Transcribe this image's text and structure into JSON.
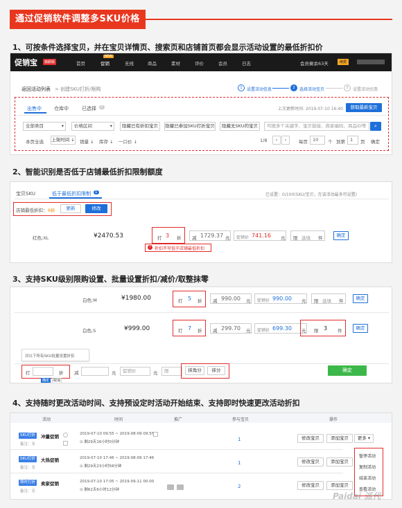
{
  "banner": {
    "title": "通过促销软件调整多SKU价格"
  },
  "headings": {
    "h1": "1、可按条件选择宝贝，并在宝贝详情页、搜索页和店铺首页都会显示活动设置的最低折扣价",
    "h2": "2、智能识别是否低于店铺最低折扣限制额度",
    "h3": "3、支持SKU级别限购设置、批量设置折扣/减价/取整抹零",
    "h4": "4、支持随时更改活动时间、支持预设定时活动开始结束、支持即时快速更改活动折扣"
  },
  "s1": {
    "logo": "促销宝",
    "logo_tag": "旗舰版",
    "nav": [
      "首页",
      "促销",
      "无线",
      "商品",
      "素材",
      "评价",
      "会员",
      "日志"
    ],
    "nav_new_badge": "NEW",
    "account": "会员剩余63天",
    "account_badge": "续费",
    "breadcrumb_link": "返回活动列表",
    "breadcrumb_rest": "> 创建SKU打折/限购",
    "steps": [
      "设置活动信息",
      "选择活动宝贝",
      "设置活动优惠"
    ],
    "step_nums": [
      "1",
      "2",
      "3"
    ],
    "tabs": [
      "出售中",
      "仓库中",
      "已选择"
    ],
    "selected_count": "0",
    "update_time": "上次更新时间: 2019-07-10 16:40",
    "sync_button": "获取最新宝贝",
    "filters": [
      "全部类目",
      "价格区间"
    ],
    "filter_buttons": [
      "隐藏已有折扣宝贝",
      "隐藏已参加SKU打折宝贝",
      "隐藏无SKU的宝贝"
    ],
    "search_placeholder": "可搜多个关键字、宝贝链接、商家编码、商品ID等",
    "row3": {
      "select_all": "本页全选",
      "sort": [
        "上架时间 ↓",
        "销量 ↓",
        "库存 ↓",
        "一口价 ↓"
      ],
      "page_info": "1/8",
      "per_page_label": "每页",
      "per_page_value": "10",
      "per_page_unit": "个",
      "goto_label": "到第",
      "goto_value": "1",
      "goto_unit": "页",
      "confirm": "确定"
    }
  },
  "s2": {
    "tabs": [
      "宝贝SKU",
      "低于最低折扣限制"
    ],
    "tab_count": "1",
    "selected_info": "已设置：0/100(SKU/宝贝，在该活动最多可设置)",
    "min_discount_label": "店铺最低折扣：",
    "min_discount_value": "6折",
    "update_button": "更新",
    "edit_button": "修改",
    "sku_name": "红色;XL",
    "price": "¥2470.53",
    "discount_prefix": "打",
    "discount_value": "3",
    "discount_unit": "折",
    "minus_prefix": "减",
    "minus_value": "1729.37",
    "minus_unit": "元",
    "promo_label": "促销价",
    "promo_value": "741.16",
    "promo_unit": "元",
    "limit_prefix": "限",
    "limit_value": "选填",
    "limit_unit": "件",
    "confirm": "确定",
    "warning": "折扣不可低于店铺最低折扣"
  },
  "s3": {
    "rows": [
      {
        "sku": "白色;M",
        "price": "¥1980.00",
        "discount": "5",
        "minus": "990.00",
        "promo": "990.00",
        "limit": "选填"
      },
      {
        "sku": "白色;S",
        "price": "¥999.00",
        "discount": "7",
        "minus": "299.70",
        "promo": "699.30",
        "limit": "3"
      }
    ],
    "labels": {
      "dz": "打",
      "zhe": "折",
      "jian": "减",
      "yuan": "元",
      "cx": "促销价",
      "xian": "限",
      "jian2": "件",
      "confirm": "确定"
    },
    "batch_hint": "对以下所有SKU批量设置折扣",
    "batch": {
      "dz": "打",
      "zhe": "折",
      "jian": "减",
      "yuan": "元",
      "cx": "促销价",
      "yuan2": "元",
      "xian": "限",
      "jian2": "件"
    },
    "round_buttons": [
      "抹角分",
      "抹分"
    ],
    "ok": "确定",
    "cancel": "取消",
    "submit": "确定"
  },
  "s4": {
    "headers": [
      "活动",
      "时间",
      "推广",
      "参与宝贝",
      "操作"
    ],
    "rows": [
      {
        "tag": "SKU打折",
        "name": "冲量促销",
        "note": "备注：无",
        "time": "2019-07-10 09:55 ~ 2019-08-09 09:55",
        "remain": "剩29天16小时0分钟",
        "count": "1",
        "edit": "修改宝贝",
        "add": "添加宝贝",
        "more": "更多 ▾"
      },
      {
        "tag": "SKU打折",
        "name": "大热促销",
        "note": "备注：无",
        "time": "2019-07-10 17:46 ~ 2019-08-09 17:46",
        "remain": "剩29天23小时58分钟",
        "count": "1",
        "edit": "修改宝贝",
        "add": "添加宝贝"
      },
      {
        "tag": "限时打折",
        "name": "卖家促销",
        "note": "备注：无",
        "time": "2019-07-10 17:05 ~ 2019-09-11 00:00",
        "remain": "剩62天6小时12分钟",
        "count": "2",
        "edit": "修改宝贝",
        "add": "添加宝贝"
      }
    ],
    "dropdown": [
      "暂停活动",
      "复制活动",
      "结束活动",
      "查看活动"
    ]
  },
  "watermark": "Paidai 派代",
  "colors": {
    "red": "#e12b2b",
    "banner": "#e8371f",
    "blue": "#1e6fd9",
    "green": "#3cb84a"
  }
}
